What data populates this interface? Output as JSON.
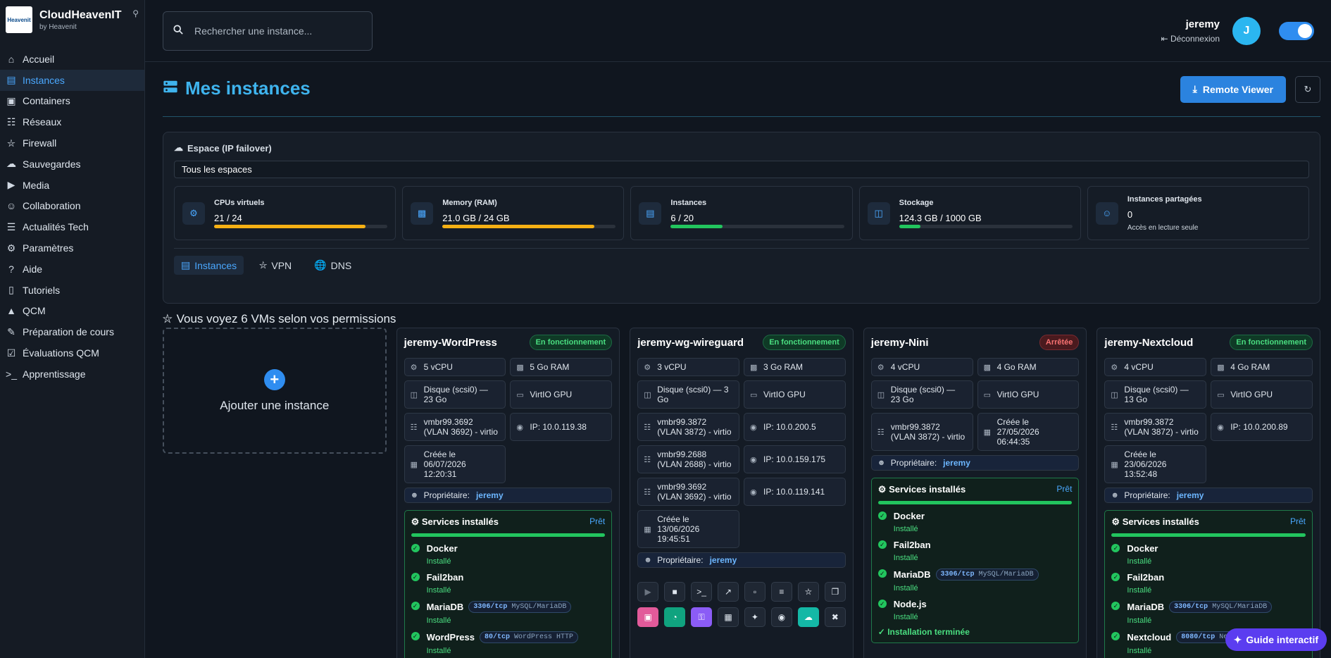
{
  "brand": {
    "title": "CloudHeavenIT",
    "subtitle": "by Heavenit",
    "logo_text": "Heavenit"
  },
  "sidebar": {
    "items": [
      {
        "label": "Accueil",
        "icon": "home-icon"
      },
      {
        "label": "Instances",
        "icon": "server-icon",
        "active": true
      },
      {
        "label": "Containers",
        "icon": "box-icon"
      },
      {
        "label": "Réseaux",
        "icon": "network-icon"
      },
      {
        "label": "Firewall",
        "icon": "shield-icon"
      },
      {
        "label": "Sauvegardes",
        "icon": "cloud-icon"
      },
      {
        "label": "Media",
        "icon": "video-icon"
      },
      {
        "label": "Collaboration",
        "icon": "users-icon"
      },
      {
        "label": "Actualités Tech",
        "icon": "newspaper-icon"
      },
      {
        "label": "Paramètres",
        "icon": "user-cog-icon"
      },
      {
        "label": "Aide",
        "icon": "help-icon"
      },
      {
        "label": "Tutoriels",
        "icon": "book-icon"
      },
      {
        "label": "QCM",
        "icon": "graduation-icon"
      },
      {
        "label": "Préparation de cours",
        "icon": "teacher-icon"
      },
      {
        "label": "Évaluations QCM",
        "icon": "clipboard-icon"
      },
      {
        "label": "Apprentissage",
        "icon": "terminal-icon"
      }
    ]
  },
  "search": {
    "placeholder": "Rechercher une instance..."
  },
  "user": {
    "name": "jeremy",
    "logout": "Déconnexion",
    "avatar_letter": "J"
  },
  "page": {
    "title": "Mes instances",
    "remote_viewer": "Remote Viewer"
  },
  "space": {
    "label": "Espace (IP failover)",
    "selected": "Tous les espaces"
  },
  "stats": [
    {
      "title": "CPUs virtuels",
      "value": "21 / 24",
      "fill": 0.875,
      "color": "#f5b014",
      "icon": "cpu-icon"
    },
    {
      "title": "Memory (RAM)",
      "value": "21.0 GB / 24 GB",
      "fill": 0.875,
      "color": "#f5b014",
      "icon": "memory-icon"
    },
    {
      "title": "Instances",
      "value": "6 / 20",
      "fill": 0.3,
      "color": "#22c55e",
      "icon": "server-icon"
    },
    {
      "title": "Stockage",
      "value": "124.3 GB / 1000 GB",
      "fill": 0.124,
      "color": "#22c55e",
      "icon": "storage-icon"
    },
    {
      "title": "Instances partagées",
      "value": "0",
      "sub": "Accès en lecture seule",
      "icon": "users-icon"
    }
  ],
  "tabs": [
    "Instances",
    "VPN",
    "DNS"
  ],
  "permissions": "Vous voyez 6 VMs selon vos permissions",
  "add_instance": "Ajouter une instance",
  "owner_label": "Propriétaire:",
  "services_title": "Services installés",
  "ready": "Prêt",
  "installed": "Installé",
  "install_done": "Installation terminée",
  "guide": "Guide interactif",
  "cards": [
    {
      "name": "jeremy-WordPress",
      "status": "En fonctionnement",
      "state": "run",
      "cpu": "5 vCPU",
      "ram": "5 Go RAM",
      "disk": "Disque (scsi0) — 23 Go",
      "gpu": "VirtIO GPU",
      "nets": [
        {
          "bridge": "vmbr99.3692 (VLAN 3692) - virtio",
          "ip": "IP: 10.0.119.38"
        }
      ],
      "created": "Créée le 06/07/2026 12:20:31",
      "owner": "jeremy",
      "services": [
        {
          "name": "Docker"
        },
        {
          "name": "Fail2ban"
        },
        {
          "name": "MariaDB",
          "port": "3306/tcp",
          "proto": "MySQL/MariaDB"
        },
        {
          "name": "WordPress",
          "port": "80/tcp",
          "proto": "WordPress HTTP"
        }
      ]
    },
    {
      "name": "jeremy-wg-wireguard",
      "status": "En fonctionnement",
      "state": "run",
      "cpu": "3 vCPU",
      "ram": "3 Go RAM",
      "disk": "Disque (scsi0) — 3 Go",
      "gpu": "VirtIO GPU",
      "nets": [
        {
          "bridge": "vmbr99.3872 (VLAN 3872) - virtio",
          "ip": "IP: 10.0.200.5"
        },
        {
          "bridge": "vmbr99.2688 (VLAN 2688) - virtio",
          "ip": "IP: 10.0.159.175"
        },
        {
          "bridge": "vmbr99.3692 (VLAN 3692) - virtio",
          "ip": "IP: 10.0.119.141"
        }
      ],
      "created": "Créée le 13/06/2026 19:45:51",
      "owner": "jeremy",
      "services": []
    },
    {
      "name": "jeremy-Nini",
      "status": "Arrêtée",
      "state": "stop",
      "cpu": "4 vCPU",
      "ram": "4 Go RAM",
      "disk": "Disque (scsi0) — 23 Go",
      "gpu": "VirtIO GPU",
      "nets": [
        {
          "bridge": "vmbr99.3872 (VLAN 3872) - virtio",
          "ip": ""
        }
      ],
      "created": "Créée le 27/05/2026 06:44:35",
      "owner": "jeremy",
      "services": [
        {
          "name": "Docker"
        },
        {
          "name": "Fail2ban"
        },
        {
          "name": "MariaDB",
          "port": "3306/tcp",
          "proto": "MySQL/MariaDB"
        },
        {
          "name": "Node.js"
        }
      ],
      "done": true
    },
    {
      "name": "jeremy-Nextcloud",
      "status": "En fonctionnement",
      "state": "run",
      "cpu": "4 vCPU",
      "ram": "4 Go RAM",
      "disk": "Disque (scsi0) — 13 Go",
      "gpu": "VirtIO GPU",
      "nets": [
        {
          "bridge": "vmbr99.3872 (VLAN 3872) - virtio",
          "ip": "IP: 10.0.200.89"
        }
      ],
      "created": "Créée le 23/06/2026 13:52:48",
      "owner": "jeremy",
      "services": [
        {
          "name": "Docker"
        },
        {
          "name": "Fail2ban"
        },
        {
          "name": "MariaDB",
          "port": "3306/tcp",
          "proto": "MySQL/MariaDB"
        },
        {
          "name": "Nextcloud",
          "port": "8080/tcp",
          "proto": "Ne..."
        }
      ]
    }
  ]
}
